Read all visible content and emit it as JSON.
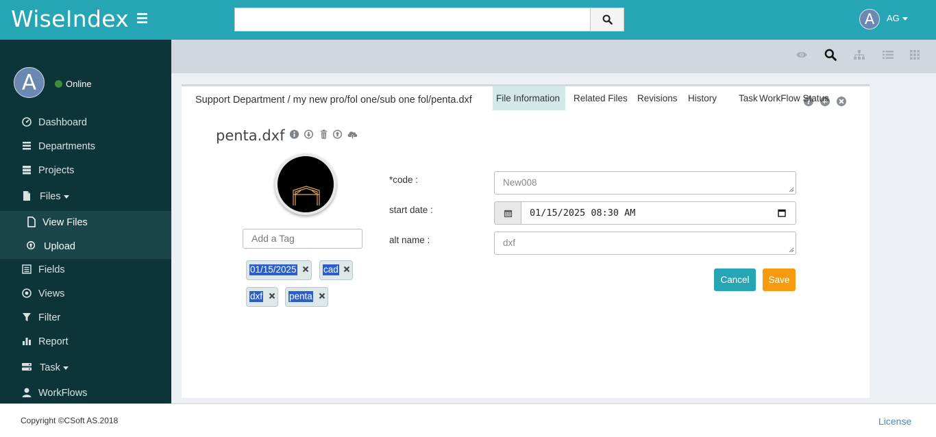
{
  "app": {
    "brand": "WiseIndex"
  },
  "header": {
    "search_placeholder": "",
    "user_avatar_letter": "A",
    "user_initials": "AG"
  },
  "sidebar": {
    "avatar_letter": "A",
    "status": "Online",
    "items": [
      {
        "label": "Dashboard",
        "icon": "dashboard-icon"
      },
      {
        "label": "Departments",
        "icon": "list-icon"
      },
      {
        "label": "Projects",
        "icon": "server-icon"
      },
      {
        "label": "Files",
        "icon": "file-icon"
      },
      {
        "label": "Fields",
        "icon": "list-alt-icon"
      },
      {
        "label": "Views",
        "icon": "dot-circle-icon"
      },
      {
        "label": "Filter",
        "icon": "filter-icon"
      },
      {
        "label": "Report",
        "icon": "bar-chart-icon"
      },
      {
        "label": "Task",
        "icon": "tasks-icon"
      },
      {
        "label": "WorkFlows",
        "icon": "user-icon"
      }
    ],
    "sub_items": [
      {
        "label": "View Files",
        "icon": "file-outline-icon"
      },
      {
        "label": "Upload",
        "icon": "upload-circle-icon"
      }
    ]
  },
  "toolbar": {
    "icons": [
      "eye-icon",
      "search-icon",
      "sitemap-icon",
      "list-view-icon",
      "grid-view-icon"
    ]
  },
  "panel": {
    "breadcrumb": "Support Department / my new pro/fol one/sub one fol/penta.dxf",
    "file_title": "penta.dxf",
    "tag_placeholder": "Add a Tag",
    "tags": [
      "01/15/2025",
      "cad",
      "dxf",
      "penta"
    ],
    "tabs": [
      "File Information",
      "Related Files",
      "Revisions",
      "History",
      "Task",
      "WorkFlow Status"
    ],
    "active_tab": "File Information",
    "form": {
      "code_label": "*code :",
      "code_value": "New008",
      "start_date_label": "start date :",
      "start_date_value": "01/15/2025 08:30 AM",
      "alt_name_label": "alt name :",
      "alt_name_value": "dxf"
    },
    "cancel_label": "Cancel",
    "save_label": "Save"
  },
  "footer": {
    "copyright": "Copyright ©CSoft AS.2018",
    "license": "License"
  },
  "colors": {
    "topbar": "#26a6b5",
    "sidebar": "#0d3438",
    "save": "#f79a10",
    "cancel": "#26a6b5",
    "tag_highlight": "#2a5fc9"
  }
}
